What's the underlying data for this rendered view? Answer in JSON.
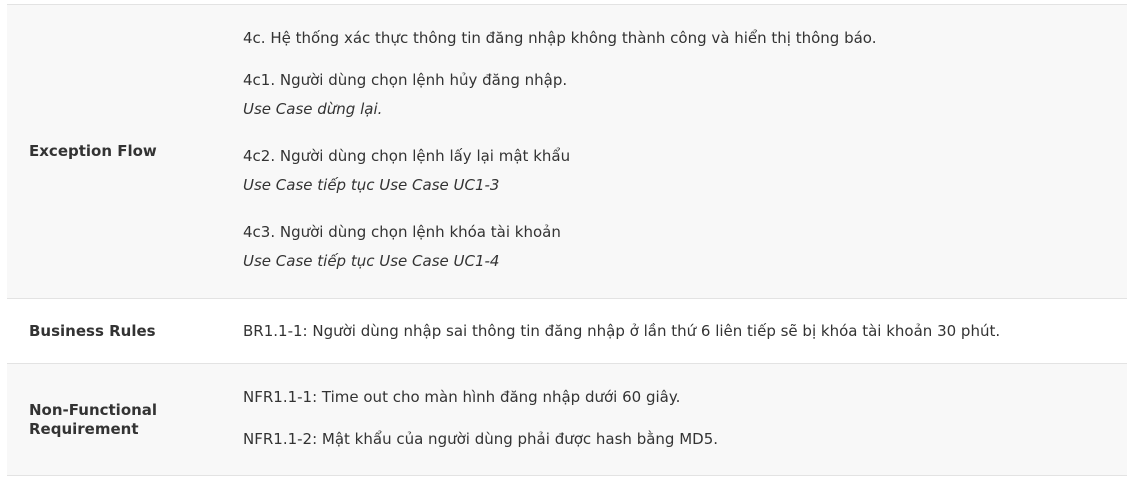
{
  "rows": {
    "exception": {
      "label": "Exception Flow",
      "line_4c": "4c. Hệ thống xác thực thông tin đăng nhập không thành công và hiển thị thông báo.",
      "line_4c1": "4c1. Người dùng chọn lệnh hủy đăng nhập.",
      "line_4c1_note": "Use Case dừng lại.",
      "line_4c2": "4c2. Người dùng chọn lệnh lấy lại mật khẩu",
      "line_4c2_note": "Use Case tiếp tục Use Case UC1-3",
      "line_4c3": "4c3. Người dùng chọn lệnh khóa tài khoản",
      "line_4c3_note": "Use Case tiếp tục Use Case UC1-4"
    },
    "business": {
      "label": "Business Rules",
      "text": "BR1.1-1: Người dùng nhập sai thông tin đăng nhập ở lần thứ 6 liên tiếp sẽ bị khóa tài khoản 30 phút."
    },
    "nfr": {
      "label_line1": "Non-Functional",
      "label_line2": "Requirement",
      "text_1": "NFR1.1-1: Time out cho màn hình đăng nhập dưới 60 giây.",
      "text_2": "NFR1.1-2: Mật khẩu của người dùng phải được hash bằng MD5."
    }
  }
}
